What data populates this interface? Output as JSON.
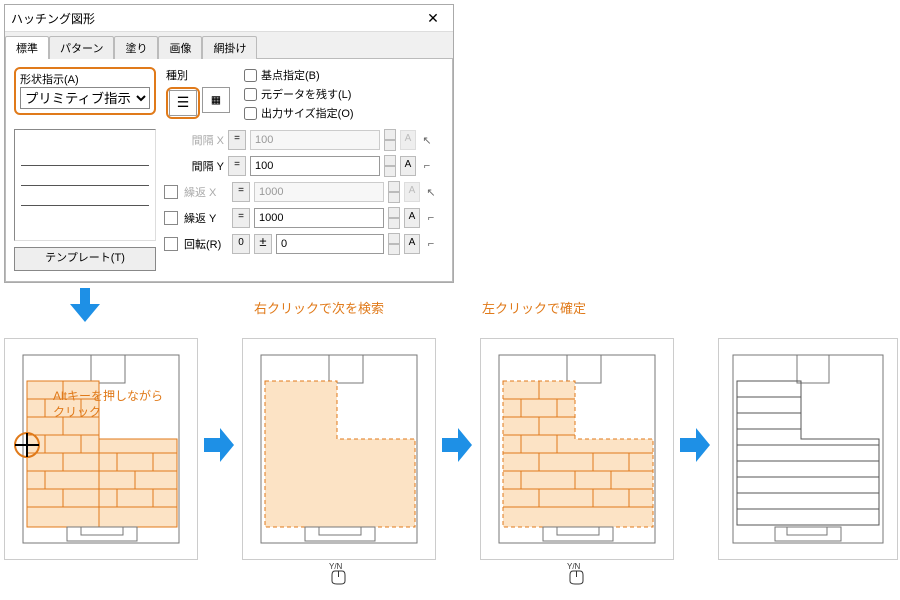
{
  "dialog": {
    "title": "ハッチング図形",
    "tabs": [
      "標準",
      "パターン",
      "塗り",
      "画像",
      "網掛け"
    ],
    "activeTab": 0,
    "shape": {
      "label": "形状指示(A)",
      "selected": "プリミティブ指示"
    },
    "type": {
      "label": "種別"
    },
    "checks": [
      {
        "label": "基点指定(B)"
      },
      {
        "label": "元データを残す(L)"
      },
      {
        "label": "出力サイズ指定(O)"
      }
    ],
    "params": {
      "spacingX": {
        "label": "間隔 X",
        "value": "100",
        "enabled": false
      },
      "spacingY": {
        "label": "間隔 Y",
        "value": "100",
        "enabled": true
      },
      "repeatX": {
        "label": "繰返 X",
        "value": "1000",
        "enabled": false
      },
      "repeatY": {
        "label": "繰返 Y",
        "value": "1000",
        "enabled": true
      },
      "rotate": {
        "label": "回転(R)",
        "value": "0",
        "sign": "0",
        "pm": "±"
      }
    },
    "eq": "=",
    "aBtn": "A",
    "templateBtn": "テンプレート(T)"
  },
  "anno": {
    "alt": "Altキーを押しながら\nクリック",
    "rightClick": "右クリックで次を検索",
    "leftClick": "左クリックで確定",
    "yn": "Y/N"
  }
}
